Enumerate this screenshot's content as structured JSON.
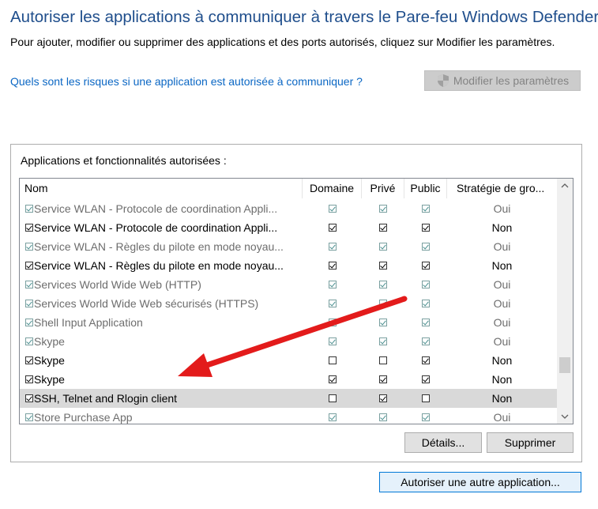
{
  "header": {
    "title": "Autoriser les applications à communiquer à travers le Pare-feu Windows Defender",
    "description": "Pour ajouter, modifier ou supprimer des applications et des ports autorisés, cliquez sur Modifier les paramètres.",
    "risk_link": "Quels sont les risques si une application est autorisée à communiquer ?",
    "modify_button": "Modifier les paramètres"
  },
  "group": {
    "label": "Applications et fonctionnalités autorisées :"
  },
  "columns": {
    "name": "Nom",
    "domain": "Domaine",
    "private": "Privé",
    "public": "Public",
    "policy": "Stratégie de gro..."
  },
  "rows": [
    {
      "name": "Service WLAN - Protocole de coordination Appli...",
      "enabled": true,
      "managed": true,
      "domain": true,
      "private": true,
      "public": true,
      "policy": "Oui"
    },
    {
      "name": "Service WLAN - Protocole de coordination Appli...",
      "enabled": true,
      "managed": false,
      "domain": true,
      "private": true,
      "public": true,
      "policy": "Non"
    },
    {
      "name": "Service WLAN - Règles du pilote en mode noyau...",
      "enabled": true,
      "managed": true,
      "domain": true,
      "private": true,
      "public": true,
      "policy": "Oui"
    },
    {
      "name": "Service WLAN - Règles du pilote en mode noyau...",
      "enabled": true,
      "managed": false,
      "domain": true,
      "private": true,
      "public": true,
      "policy": "Non"
    },
    {
      "name": "Services World Wide Web (HTTP)",
      "enabled": true,
      "managed": true,
      "domain": true,
      "private": true,
      "public": true,
      "policy": "Oui"
    },
    {
      "name": "Services World Wide Web sécurisés (HTTPS)",
      "enabled": true,
      "managed": true,
      "domain": true,
      "private": true,
      "public": true,
      "policy": "Oui"
    },
    {
      "name": "Shell Input Application",
      "enabled": true,
      "managed": true,
      "domain": true,
      "private": true,
      "public": true,
      "policy": "Oui"
    },
    {
      "name": "Skype",
      "enabled": true,
      "managed": true,
      "domain": true,
      "private": true,
      "public": true,
      "policy": "Oui"
    },
    {
      "name": "Skype",
      "enabled": true,
      "managed": false,
      "domain": false,
      "private": false,
      "public": true,
      "policy": "Non"
    },
    {
      "name": "Skype",
      "enabled": true,
      "managed": false,
      "domain": true,
      "private": true,
      "public": true,
      "policy": "Non"
    },
    {
      "name": "SSH, Telnet and Rlogin client",
      "enabled": true,
      "managed": false,
      "selected": true,
      "domain": false,
      "private": true,
      "public": false,
      "policy": "Non"
    },
    {
      "name": "Store Purchase App",
      "enabled": true,
      "managed": true,
      "domain": true,
      "private": true,
      "public": true,
      "policy": "Oui"
    }
  ],
  "buttons": {
    "details": "Détails...",
    "remove": "Supprimer",
    "allow_another": "Autoriser une autre application..."
  },
  "scrollbar": {
    "up_icon": "chevron-up-icon",
    "down_icon": "chevron-down-icon"
  },
  "annotation": {
    "color": "#e31b1b"
  },
  "colors": {
    "title": "#1f4e8c",
    "link": "#0b67c4",
    "selected_row": "#d9d9d9"
  }
}
